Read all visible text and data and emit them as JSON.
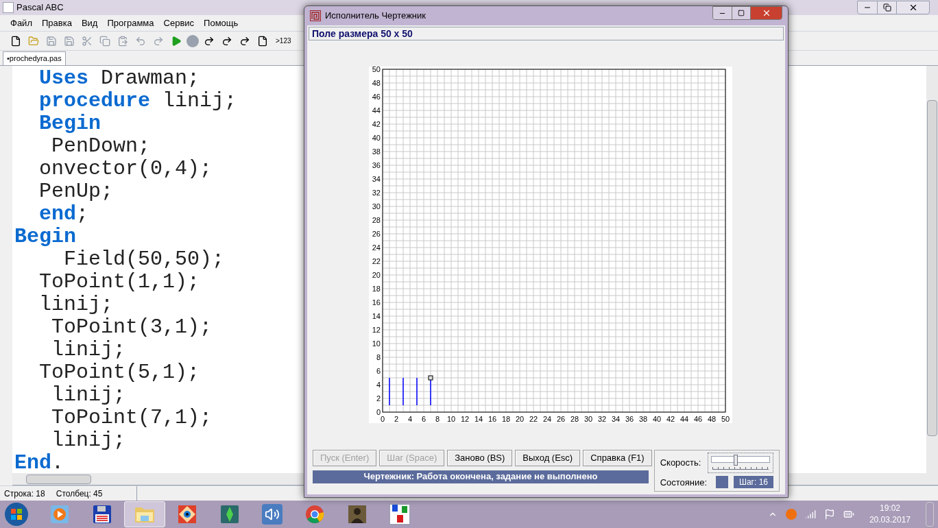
{
  "window": {
    "title": "Pascal ABC"
  },
  "menu": [
    "Файл",
    "Правка",
    "Вид",
    "Программа",
    "Сервис",
    "Помощь"
  ],
  "toolbar": {
    "counter_label": ">123"
  },
  "tabs": [
    {
      "label": "•prochedyra.pas",
      "selected": true
    }
  ],
  "code_lines": [
    "  **Uses** Drawman;",
    "  **procedure** linij;",
    "  **Begin**",
    "   PenDown;",
    "  onvector(0,4);",
    "  PenUp;",
    "  **end**;",
    "**Begin**",
    "    Field(50,50);",
    "  ToPoint(1,1);",
    "  linij;",
    "   ToPoint(3,1);",
    "   linij;",
    "  ToPoint(5,1);",
    "   linij;",
    "   ToPoint(7,1);",
    "   linij;",
    "**End**."
  ],
  "status_bar": {
    "row": "Строка: 18",
    "column": "Столбец: 45"
  },
  "dialog": {
    "title": "Исполнитель Чертежник",
    "header": "Поле размера 50 x 50",
    "field": {
      "chart_data": {
        "type": "line",
        "x": [
          1,
          1,
          2,
          3,
          3,
          4,
          5,
          5,
          6,
          7,
          7
        ],
        "series": [
          {
            "color": "#0000ff",
            "values": [
              1,
              5,
              null,
              1,
              5,
              null,
              1,
              5,
              null,
              1,
              5
            ]
          }
        ],
        "grid": true,
        "xlim": [
          0,
          50
        ],
        "ylim": [
          0,
          50
        ],
        "xticks": [
          0,
          2,
          4,
          6,
          8,
          10,
          12,
          14,
          16,
          18,
          20,
          22,
          24,
          26,
          28,
          30,
          32,
          34,
          36,
          38,
          40,
          42,
          44,
          46,
          48,
          50
        ],
        "yticks": [
          0,
          2,
          4,
          6,
          8,
          10,
          12,
          14,
          16,
          18,
          20,
          22,
          24,
          26,
          28,
          30,
          32,
          34,
          36,
          38,
          40,
          42,
          44,
          46,
          48,
          50
        ]
      }
    },
    "buttons": [
      {
        "label": "Пуск (Enter)",
        "disabled": true
      },
      {
        "label": "Шаг (Space)",
        "disabled": true
      },
      {
        "label": "Заново (BS)",
        "disabled": false
      },
      {
        "label": "Выход (Esc)",
        "disabled": false
      },
      {
        "label": "Справка (F1)",
        "disabled": false
      }
    ],
    "speed_label": "Скорость:",
    "speed": {
      "level": 0.4
    },
    "state_label": "Состояние:",
    "step": "Шаг: 16",
    "message": "Чертежник: Работа окончена, задание не выполнено"
  },
  "taskbar": {
    "apps": [
      {
        "kind": "media",
        "selected": false
      },
      {
        "kind": "floppy",
        "selected": false
      },
      {
        "kind": "folder",
        "selected": true
      },
      {
        "kind": "eye",
        "selected": false
      },
      {
        "kind": "gem",
        "selected": false
      },
      {
        "kind": "speaker",
        "selected": false
      },
      {
        "kind": "browser",
        "selected": false
      },
      {
        "kind": "person",
        "selected": false
      },
      {
        "kind": "abc",
        "selected": false
      }
    ],
    "time": "19:02",
    "date": "20.03.2017"
  }
}
